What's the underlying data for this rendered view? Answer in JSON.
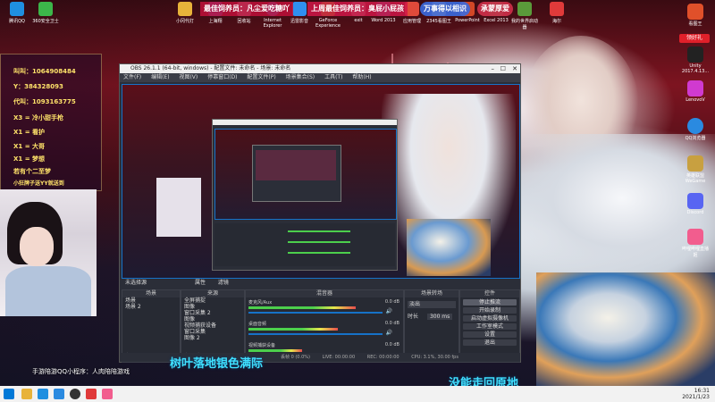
{
  "desktop": {
    "top_icons": [
      {
        "label": "腾讯QQ",
        "color": "#1f8fe0"
      },
      {
        "label": "360安全卫士",
        "color": "#3cb64a"
      },
      {
        "label": "小冈代打",
        "color": "#e8b33a"
      },
      {
        "label": "上海翔",
        "color": "#3b6ed6"
      },
      {
        "label": "回收站",
        "color": "#9aa6b2"
      },
      {
        "label": "Internet Explorer",
        "color": "#2a7de1"
      },
      {
        "label": "迅雷影音",
        "color": "#2f8ff0"
      },
      {
        "label": "GeForce Experience",
        "color": "#76b900"
      },
      {
        "label": "exit",
        "color": "#777777"
      },
      {
        "label": "Word 2013",
        "color": "#2b579a"
      },
      {
        "label": "应用管理",
        "color": "#e04a3a"
      },
      {
        "label": "2345看图王",
        "color": "#f0a030"
      },
      {
        "label": "PowerPoint",
        "color": "#d24726"
      },
      {
        "label": "Excel 2013",
        "color": "#217346"
      },
      {
        "label": "我的世界启动器",
        "color": "#5a9a3a"
      },
      {
        "label": "网易云",
        "color": "#e03a3a"
      },
      {
        "label": "海尔",
        "color": "#e05a1a"
      }
    ],
    "banners": [
      {
        "text": "最佳饲养员：凡尘爱吃糖吖",
        "color": "#c0103a"
      },
      {
        "text": "上周最佳饲养员：臭屁小屁孩",
        "color": "#d01848"
      },
      {
        "text": "万事得以相识",
        "color": "#3a6ae0"
      },
      {
        "text": "承蒙厚爱",
        "color": "#d0304a"
      }
    ],
    "right_icons": [
      {
        "label": "看图王",
        "color": "#e0502a"
      },
      {
        "label": "BSMC",
        "color": "#eeeeee"
      },
      {
        "label": "Unity 2017.4.13...",
        "color": "#111111"
      },
      {
        "label": "LenovoV",
        "color": "#d03ad0"
      },
      {
        "label": "QQ浏览器",
        "color": "#2a8ae0"
      },
      {
        "label": "英雄联盟WeGame",
        "color": "#c8a040"
      },
      {
        "label": "Discord",
        "color": "#5865f2"
      },
      {
        "label": "哔哩哔哩直播姬",
        "color": "#f25d8e"
      },
      {
        "label": "我的好伙伴",
        "color": "#e04080"
      }
    ],
    "right_button": "领好礼"
  },
  "rank_overlay": {
    "lines": [
      "叫叫：1064908484",
      "Y：384328093",
      "代叫：1093163775",
      "X3 = 冷小甜手枪",
      "X1 = 看护",
      "X1 = 大哥",
      "X1 = 梦想",
      "若有个二至梦",
      "小狂牌子送YY就送到"
    ]
  },
  "obs": {
    "title": "OBS 26.1.1 (64-bit, windows) - 配置文件: 未命名 - 场景: 未命名",
    "menu": [
      "文件(F)",
      "编辑(E)",
      "视图(V)",
      "停靠窗口(D)",
      "配置文件(P)",
      "场景集合(S)",
      "工具(T)",
      "帮助(H)"
    ],
    "preview_toolbar": {
      "selected_label": "未选择源",
      "buttons": [
        "属性",
        "滤镜"
      ]
    },
    "docks": {
      "scenes": {
        "title": "场景",
        "items": [
          "场景",
          "场景 2"
        ]
      },
      "sources": {
        "title": "来源",
        "items": [
          "全屏捕捉",
          "图像",
          "窗口采集 2",
          "图像",
          "视频捕获设备",
          "窗口采集",
          "图像 2"
        ]
      },
      "mixer": {
        "title": "混音器",
        "channels": [
          {
            "name": "麦克风/Aux",
            "db": "0.0 dB"
          },
          {
            "name": "桌面音频",
            "db": "0.0 dB"
          },
          {
            "name": "视频捕获设备",
            "db": "0.0 dB"
          }
        ]
      },
      "transitions": {
        "title": "场景转场",
        "type": "淡出",
        "duration_label": "时长",
        "duration": "300 ms"
      },
      "controls": {
        "title": "控件",
        "buttons": [
          "停止推流",
          "开始录制",
          "启动虚拟摄像机",
          "工作室模式",
          "设置",
          "退出"
        ]
      }
    },
    "status": {
      "drop": "丢帧 0 (0.0%)",
      "live": "LIVE: 00:00:00",
      "rec": "REC: 00:00:00",
      "cpu": "CPU: 3.1%, 30.00 fps"
    }
  },
  "lyrics": {
    "left": "树叶落地银色满际",
    "right": "没能走回原地"
  },
  "footer_note": "手游陪游QQ小程序：人肉陪陪游戏",
  "taskbar": {
    "time": "16:31",
    "date": "2021/1/23"
  }
}
